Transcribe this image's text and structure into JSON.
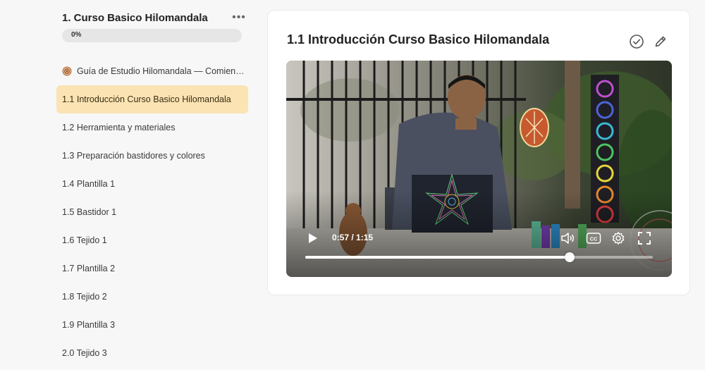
{
  "sidebar": {
    "course_title": "1. Curso Basico Hilomandala",
    "more_label": "•••",
    "progress": {
      "value": 0,
      "label": "0%"
    },
    "lessons": [
      {
        "label": "Guía de Estudio Hilomandala — Comienza aquí",
        "icon": "guide-icon",
        "active": false
      },
      {
        "label": "1.1 Introducción Curso Basico Hilomandala",
        "active": true
      },
      {
        "label": "1.2 Herramienta y materiales",
        "active": false
      },
      {
        "label": "1.3 Preparación bastidores y colores",
        "active": false
      },
      {
        "label": "1.4 Plantilla 1",
        "active": false
      },
      {
        "label": "1.5 Bastidor 1",
        "active": false
      },
      {
        "label": "1.6 Tejido 1",
        "active": false
      },
      {
        "label": "1.7 Plantilla 2",
        "active": false
      },
      {
        "label": "1.8 Tejido 2",
        "active": false
      },
      {
        "label": "1.9 Plantilla 3",
        "active": false
      },
      {
        "label": "2.0 Tejido 3",
        "active": false
      }
    ]
  },
  "main": {
    "lesson_title": "1.1 Introducción Curso Basico Hilomandala",
    "video": {
      "current_time": "0:57",
      "duration": "1:15",
      "time_display": "0:57 / 1:15",
      "progress_fraction": 0.76
    }
  },
  "colors": {
    "active_bg": "#fbe3b4",
    "progress_track": "#e6e6e6",
    "accent": "#c9a45c"
  }
}
